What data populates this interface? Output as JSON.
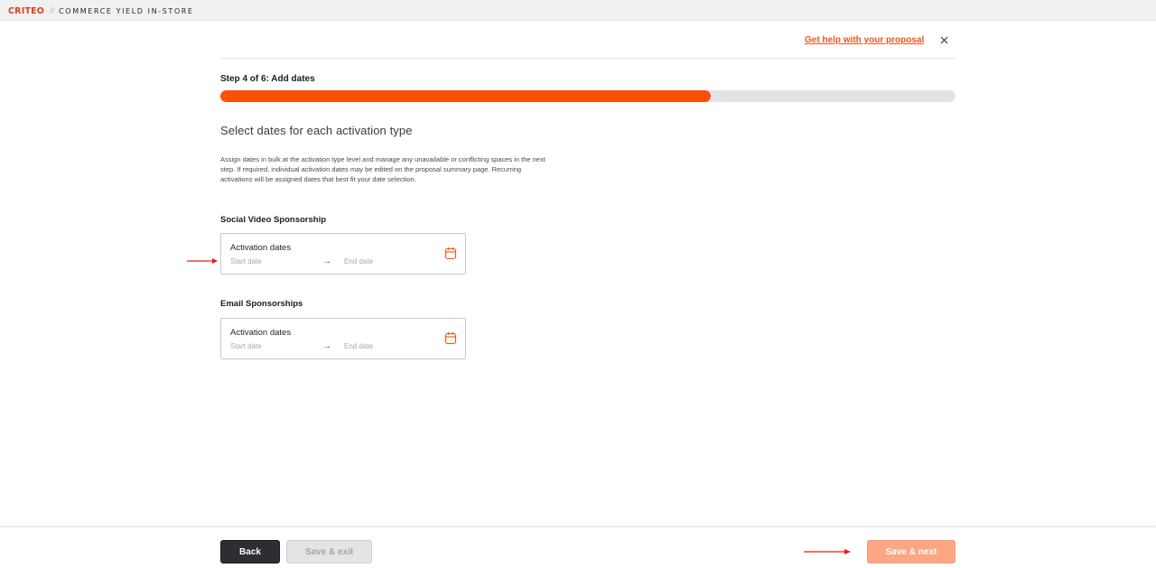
{
  "brand": {
    "logo_prefix": "CR",
    "logo_mid": "I",
    "logo_suffix": "TEO",
    "separator": "//",
    "product": "COMMERCE YIELD IN-STORE"
  },
  "header": {
    "help_link": "Get help with your proposal",
    "close_icon": "close-icon"
  },
  "step": {
    "label": "Step 4 of 6: Add dates",
    "progress": 0.667
  },
  "section": {
    "title": "Select dates for each activation type",
    "description": "Assign dates in bulk at the activation type level and manage any unavailable or conflicting spaces in the next step. If required, individual activation dates may be edited on the proposal summary page. Recurring activations will be assigned dates that best fit your date selection."
  },
  "groups": [
    {
      "title": "Social Video Sponsorship",
      "card_label": "Activation dates",
      "start_placeholder": "Start date",
      "arrow": "→",
      "end_placeholder": "End date",
      "icon": "calendar-icon"
    },
    {
      "title": "Email Sponsorships",
      "card_label": "Activation dates",
      "start_placeholder": "Start date",
      "arrow": "→",
      "end_placeholder": "End date",
      "icon": "calendar-icon"
    }
  ],
  "footer": {
    "back": "Back",
    "save_exit": "Save & exit",
    "save_next": "Save & next"
  },
  "colors": {
    "accent": "#fa5008",
    "link": "#f0541e",
    "annotation": "#e0201b",
    "progress_track": "#e3e3e5"
  }
}
